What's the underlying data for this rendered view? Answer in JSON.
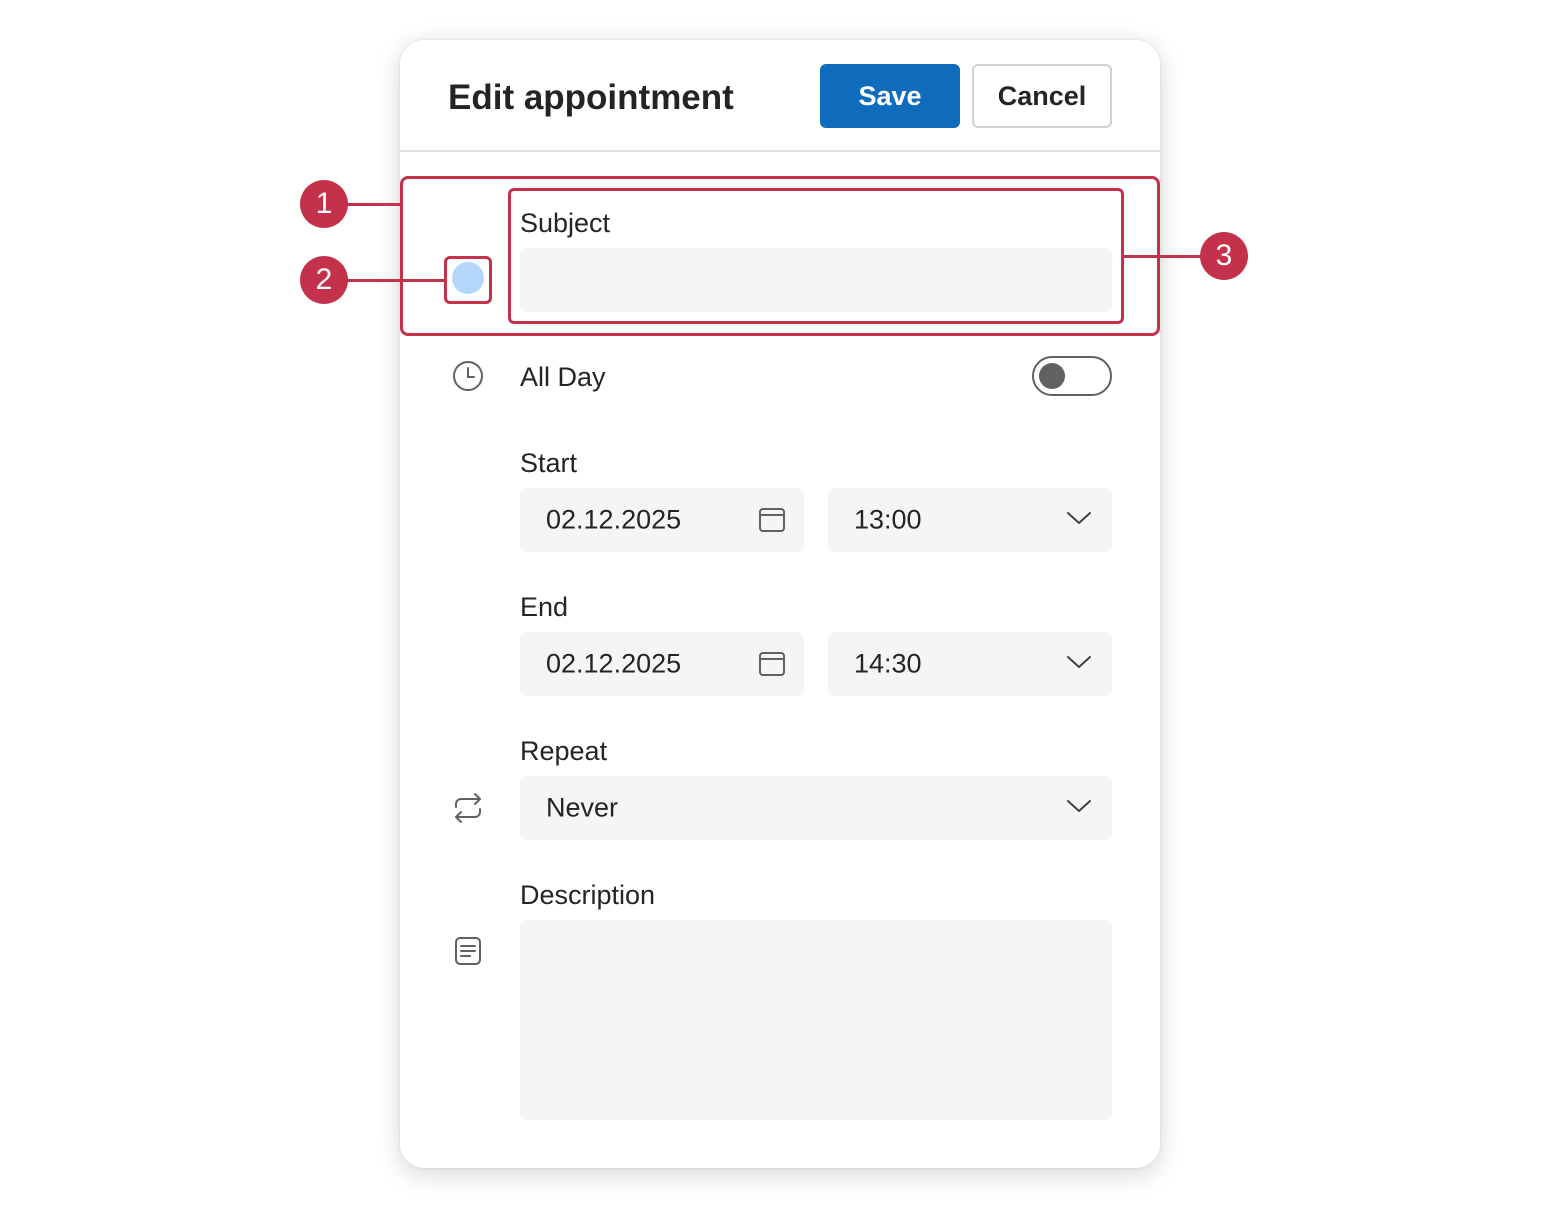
{
  "dialog": {
    "title": "Edit appointment",
    "save_label": "Save",
    "cancel_label": "Cancel"
  },
  "subject": {
    "label": "Subject",
    "value": ""
  },
  "color_picker": {
    "color": "#b4d6fa"
  },
  "all_day": {
    "label": "All Day",
    "icon": "clock-icon",
    "checked": false
  },
  "start": {
    "label": "Start",
    "date": "02.12.2025",
    "time": "13:00"
  },
  "end": {
    "label": "End",
    "date": "02.12.2025",
    "time": "14:30"
  },
  "repeat": {
    "label": "Repeat",
    "icon": "repeat-icon",
    "value": "Never"
  },
  "description": {
    "label": "Description",
    "icon": "notes-icon",
    "value": ""
  },
  "annotations": {
    "badge_1": "1",
    "badge_2": "2",
    "badge_3": "3"
  },
  "colors": {
    "accent": "#0f6cbd",
    "annotation": "#c4314b",
    "field_bg": "#f5f5f5"
  }
}
